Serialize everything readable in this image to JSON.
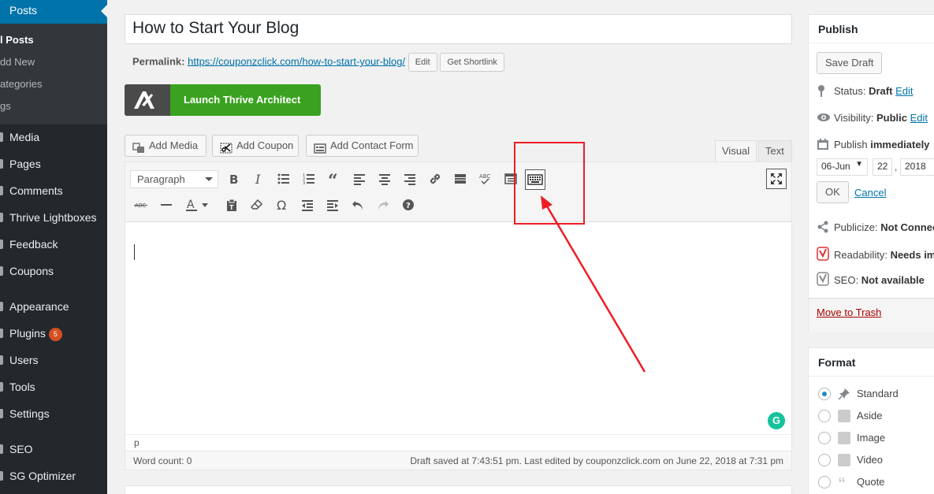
{
  "sidebar": {
    "posts_label": "Posts",
    "submenu": [
      "All Posts",
      "Add New",
      "Categories",
      "Tags"
    ],
    "items": [
      {
        "label": "Media"
      },
      {
        "label": "Pages"
      },
      {
        "label": "Comments"
      },
      {
        "label": "Thrive Lightboxes"
      },
      {
        "label": "Feedback"
      },
      {
        "label": "Coupons"
      },
      {
        "label": "Appearance"
      },
      {
        "label": "Plugins",
        "badge": "5"
      },
      {
        "label": "Users"
      },
      {
        "label": "Tools"
      },
      {
        "label": "Settings"
      },
      {
        "label": "SEO"
      },
      {
        "label": "SG Optimizer"
      }
    ],
    "visible_submenu": [
      "l Posts",
      "dd New",
      "ategories",
      "gs"
    ]
  },
  "post": {
    "title": "How to Start Your Blog",
    "permalink_label": "Permalink:",
    "permalink_url": "https://couponzclick.com/how-to-start-your-blog/",
    "edit_label": "Edit",
    "shortlink_label": "Get Shortlink"
  },
  "thrive": {
    "label": "Launch Thrive Architect"
  },
  "media_buttons": {
    "add_media": "Add Media",
    "add_coupon": "Add Coupon",
    "add_contact_form": "Add Contact Form"
  },
  "tabs": {
    "visual": "Visual",
    "text": "Text"
  },
  "editor": {
    "format_value": "Paragraph",
    "path": "p",
    "word_count": "Word count: 0",
    "draft_saved": "Draft saved at 7:43:51 pm. Last edited by couponzclick.com on June 22, 2018 at 7:31 pm"
  },
  "publish": {
    "title": "Publish",
    "save_draft": "Save Draft",
    "status_label": "Status:",
    "status_value": "Draft",
    "visibility_label": "Visibility:",
    "visibility_value": "Public",
    "edit": "Edit",
    "publish_label": "Publish",
    "publish_value": "immediately",
    "month": "06-Jun",
    "day": "22",
    "year": "2018",
    "date_sep": ",",
    "ok": "OK",
    "cancel": "Cancel",
    "publicize_label": "Publicize:",
    "publicize_value": "Not Connec",
    "readability_label": "Readability:",
    "readability_value": "Needs im",
    "seo_label": "SEO:",
    "seo_value": "Not available",
    "trash": "Move to Trash"
  },
  "format": {
    "title": "Format",
    "options": [
      "Standard",
      "Aside",
      "Image",
      "Video",
      "Quote"
    ],
    "selected": "Standard"
  },
  "colors": {
    "sidebar": "#23282d",
    "accent": "#0073aa",
    "thrive_green": "#3aa220",
    "annotation_red": "#ee1c25"
  }
}
